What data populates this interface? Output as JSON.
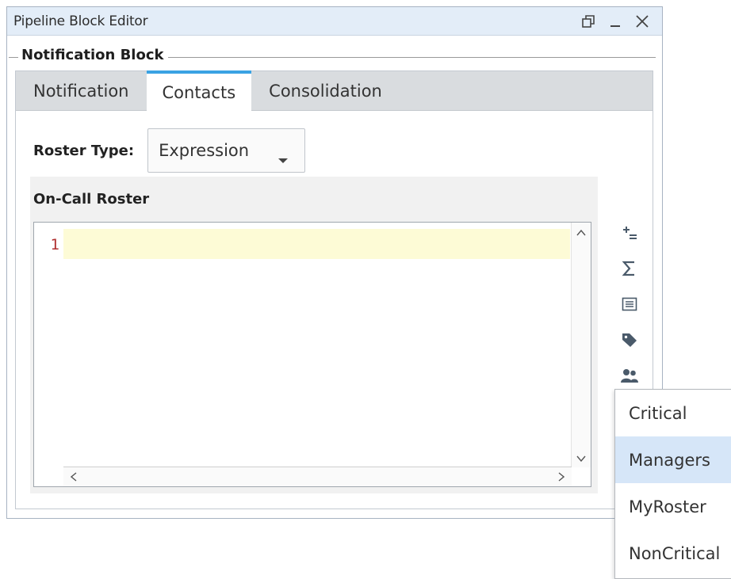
{
  "window": {
    "title": "Pipeline Block Editor"
  },
  "group": {
    "title": "Notification Block"
  },
  "tabs": [
    {
      "label": "Notification",
      "active": false
    },
    {
      "label": "Contacts",
      "active": true
    },
    {
      "label": "Consolidation",
      "active": false
    }
  ],
  "roster": {
    "label": "Roster Type:",
    "selected": "Expression"
  },
  "oncall": {
    "label": "On-Call Roster",
    "line_numbers": [
      "1"
    ]
  },
  "tools": [
    "add-operator-icon",
    "sigma-function-icon",
    "list-icon",
    "tag-icon",
    "users-icon"
  ],
  "popup": {
    "items": [
      {
        "label": "Critical",
        "selected": false
      },
      {
        "label": "Managers",
        "selected": true
      },
      {
        "label": "MyRoster",
        "selected": false
      },
      {
        "label": "NonCritical",
        "selected": false
      }
    ]
  },
  "colors": {
    "accent_tab": "#3aa2e3",
    "titlebar": "#e3edf8",
    "current_line": "#fdfbd6",
    "line_number": "#b03030",
    "popup_selected": "#d6e6f8"
  }
}
